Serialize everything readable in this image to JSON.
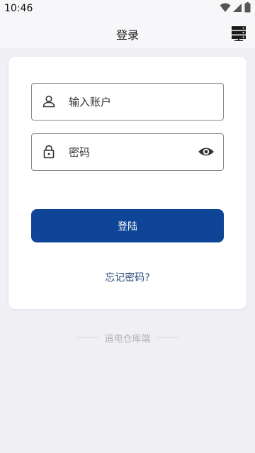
{
  "status_bar": {
    "time": "10:46"
  },
  "nav": {
    "title": "登录"
  },
  "form": {
    "account_label": "输入账户",
    "password_label": "密码",
    "login_label": "登陆",
    "forgot_label": "忘记密码?"
  },
  "footer": {
    "text": "追电仓库端"
  },
  "colors": {
    "primary": "#0e4596",
    "link": "#2c4a78",
    "background": "#efeff4"
  },
  "icons": [
    "wifi-icon",
    "signal-icon",
    "battery-icon",
    "server-icon",
    "user-icon",
    "lock-icon",
    "eye-icon"
  ]
}
